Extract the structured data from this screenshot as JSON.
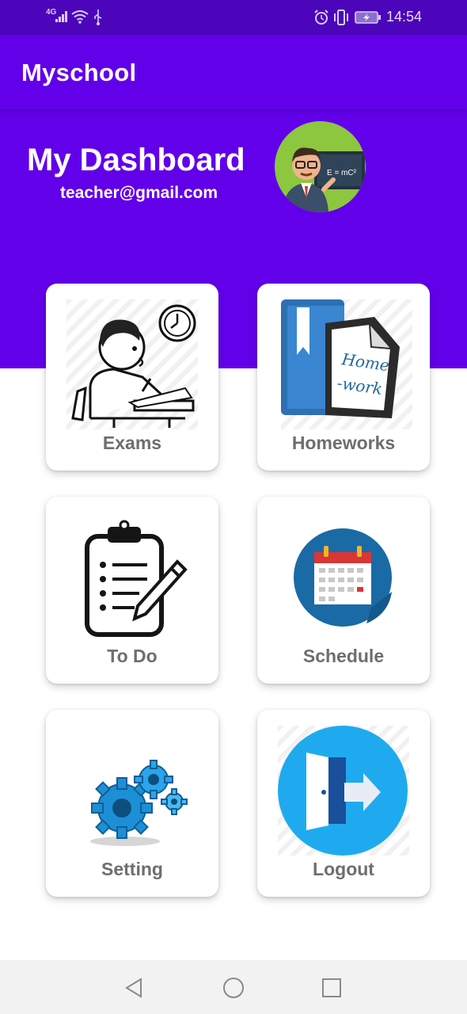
{
  "status_bar": {
    "network": "4G",
    "time": "14:54",
    "icons": [
      "signal-icon",
      "wifi-icon",
      "usb-icon",
      "alarm-icon",
      "vibrate-icon",
      "battery-icon"
    ]
  },
  "app_bar": {
    "title": "Myschool"
  },
  "header": {
    "title": "My Dashboard",
    "email": "teacher@gmail.com",
    "avatar_board_text": "E = mC²"
  },
  "tiles": [
    {
      "label": "Exams",
      "icon": "exam-icon"
    },
    {
      "label": "Homeworks",
      "icon": "homework-icon",
      "art_text": "Home -work"
    },
    {
      "label": "To Do",
      "icon": "clipboard-icon"
    },
    {
      "label": "Schedule",
      "icon": "calendar-icon"
    },
    {
      "label": "Setting",
      "icon": "gears-icon"
    },
    {
      "label": "Logout",
      "icon": "logout-icon"
    }
  ],
  "nav_bar": {
    "icons": [
      "back-icon",
      "home-icon",
      "recents-icon"
    ]
  },
  "colors": {
    "primary": "#6200ea",
    "status_bar": "#4c05ba",
    "label": "#6e6e6e"
  }
}
